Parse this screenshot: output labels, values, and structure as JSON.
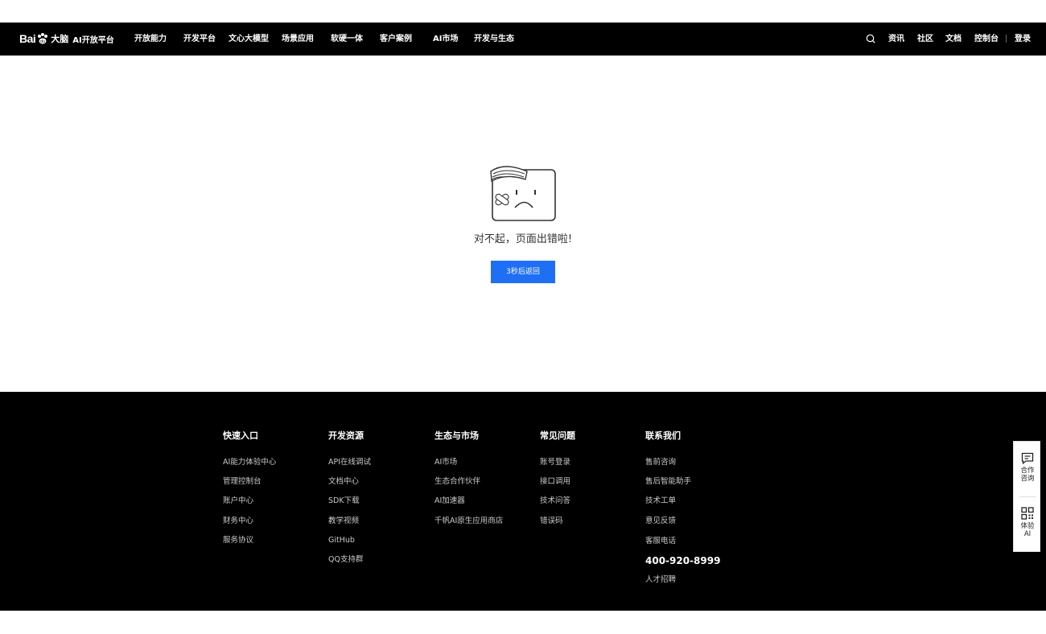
{
  "header": {
    "logo": {
      "bai": "Bai",
      "brand": "大脑",
      "sub": "AI开放平台"
    },
    "nav": [
      "开放能力",
      "开发平台",
      "文心大模型",
      "场景应用",
      "软硬一体",
      "客户案例",
      "AI市场",
      "开发与生态"
    ],
    "right": {
      "news": "资讯",
      "community": "社区",
      "docs": "文档",
      "console": "控制台",
      "login": "登录"
    }
  },
  "error": {
    "message": "对不起，页面出错啦!",
    "button": "3秒后返回"
  },
  "footer": {
    "columns": [
      {
        "title": "快速入口",
        "links": [
          "AI能力体验中心",
          "管理控制台",
          "账户中心",
          "财务中心",
          "服务协议"
        ]
      },
      {
        "title": "开发资源",
        "links": [
          "API在线调试",
          "文档中心",
          "SDK下载",
          "教学视频",
          "GitHub",
          "QQ支持群"
        ]
      },
      {
        "title": "生态与市场",
        "links": [
          "AI市场",
          "生态合作伙伴",
          "AI加速器",
          "千帆AI原生应用商店"
        ]
      },
      {
        "title": "常见问题",
        "links": [
          "账号登录",
          "接口调用",
          "技术问答",
          "错误码"
        ]
      },
      {
        "title": "联系我们",
        "links": [
          "售前咨询",
          "售后智能助手",
          "技术工单",
          "意见反馈",
          "客服电话"
        ],
        "phone": "400-920-8999",
        "after_phone": "人才招聘"
      }
    ]
  },
  "side": {
    "consult": [
      "合作",
      "咨询"
    ],
    "try": [
      "体验",
      "AI"
    ]
  },
  "colors": {
    "nav_bg": "#000000",
    "button": "#1f6ff5",
    "footer_bg": "#000000"
  }
}
